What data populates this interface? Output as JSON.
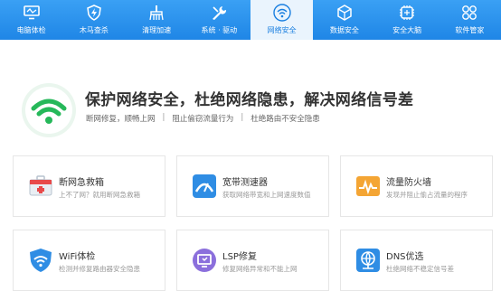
{
  "nav": {
    "items": [
      {
        "label": "电脑体检",
        "icon": "monitor-icon"
      },
      {
        "label": "木马查杀",
        "icon": "lightning-shield-icon"
      },
      {
        "label": "清理加速",
        "icon": "broom-icon"
      },
      {
        "label": "系统 · 驱动",
        "icon": "wrench-icon"
      },
      {
        "label": "网络安全",
        "icon": "wifi-icon",
        "active": true
      },
      {
        "label": "数据安全",
        "icon": "cube-icon"
      },
      {
        "label": "安全大脑",
        "icon": "brain-icon"
      },
      {
        "label": "软件管家",
        "icon": "apps-icon"
      }
    ]
  },
  "hero": {
    "title": "保护网络安全，杜绝网络隐患，解决网络信号差",
    "sub": [
      "断网修复，顺畅上网",
      "阻止偷窃流量行为",
      "杜绝路由不安全隐患"
    ],
    "separator": "|"
  },
  "cards": [
    {
      "title": "断网急救箱",
      "desc": "上不了网？就用断网急救箱",
      "icon": "first-aid-kit-icon"
    },
    {
      "title": "宽带测速器",
      "desc": "获取网络带宽和上网速度数值",
      "icon": "speedometer-icon"
    },
    {
      "title": "流量防火墙",
      "desc": "发现并阻止偷占流量的程序",
      "icon": "firewall-icon"
    },
    {
      "title": "WiFi体检",
      "desc": "检测并修复路由器安全隐患",
      "icon": "wifi-shield-icon"
    },
    {
      "title": "LSP修复",
      "desc": "修复网络异常和不能上网",
      "icon": "lsp-repair-icon"
    },
    {
      "title": "DNS优选",
      "desc": "杜绝网络不稳定信号差",
      "icon": "globe-network-icon"
    }
  ],
  "colors": {
    "nav": "#1f86e6",
    "wifi_green": "#26b85a",
    "active_bg": "#eaf4fd"
  }
}
